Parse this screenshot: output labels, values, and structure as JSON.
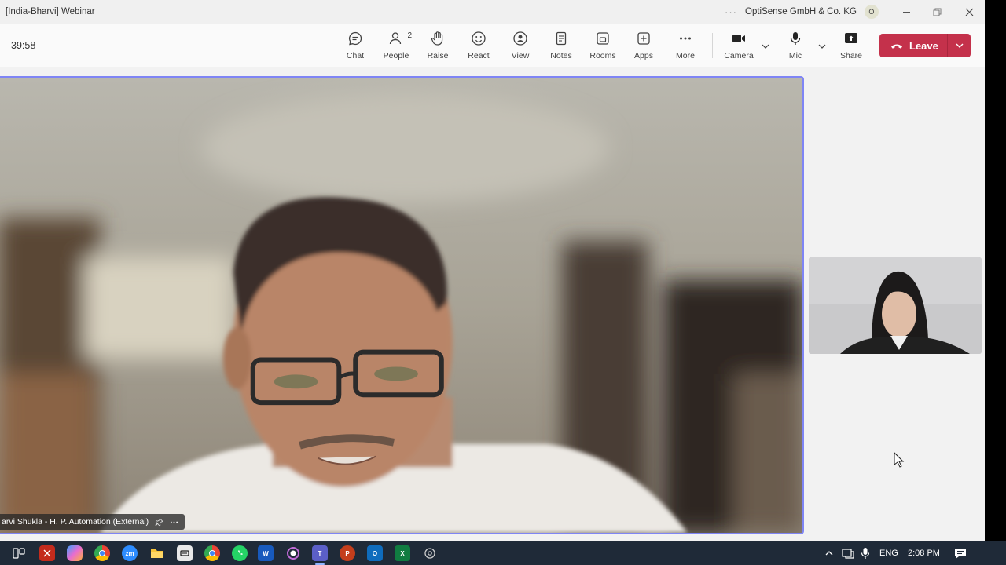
{
  "window": {
    "title": "[India-Bharvi] Webinar",
    "organization": "OptiSense GmbH & Co. KG",
    "org_avatar": "O",
    "more_icon": "more-horizontal-icon"
  },
  "meeting": {
    "timer": "39:58",
    "toolbar": {
      "chat": "Chat",
      "people": "People",
      "people_count": "2",
      "raise": "Raise",
      "react": "React",
      "view": "View",
      "notes": "Notes",
      "rooms": "Rooms",
      "apps": "Apps",
      "more": "More",
      "camera": "Camera",
      "mic": "Mic",
      "share": "Share",
      "leave": "Leave"
    },
    "main_participant": {
      "name": "arvi Shukla - H. P. Automation (External)"
    },
    "accent_color": "#7f85f5",
    "leave_color": "#c4314b"
  },
  "taskbar": {
    "apps": [
      "task-view-icon",
      "snipping-icon",
      "copilot-icon",
      "chrome-icon",
      "zoom-icon",
      "file-explorer-icon",
      "app-icon",
      "chrome-icon",
      "whatsapp-icon",
      "word-icon",
      "record-icon",
      "teams-icon",
      "powerpoint-icon",
      "outlook-icon",
      "excel-icon",
      "settings-icon"
    ],
    "zoom_label": "zm",
    "word_label": "W",
    "teams_label": "T",
    "powerpoint_label": "P",
    "outlook_label": "O",
    "excel_label": "X",
    "language": "ENG",
    "time": "2:08 PM"
  }
}
